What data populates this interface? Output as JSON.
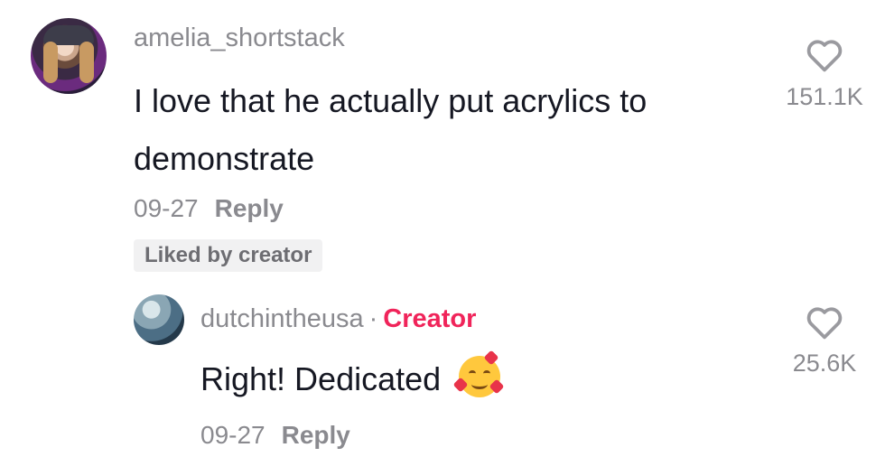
{
  "comments": [
    {
      "username": "amelia_shortstack",
      "text_line1": "I love that he actually put acrylics to",
      "text_line2": "demonstrate",
      "date": "09-27",
      "reply_label": "Reply",
      "badge": "Liked by creator",
      "like_count": "151.1K"
    },
    {
      "username": "dutchintheusa",
      "separator": "·",
      "creator_label": "Creator",
      "text": "Right! Dedicated",
      "emoji_icon": "smiling-face-with-hearts-icon",
      "date": "09-27",
      "reply_label": "Reply",
      "like_count": "25.6K"
    }
  ],
  "colors": {
    "creator": "#f0245a",
    "text": "#161823",
    "muted": "#8a8a8f",
    "badge_bg": "#f1f1f2"
  }
}
